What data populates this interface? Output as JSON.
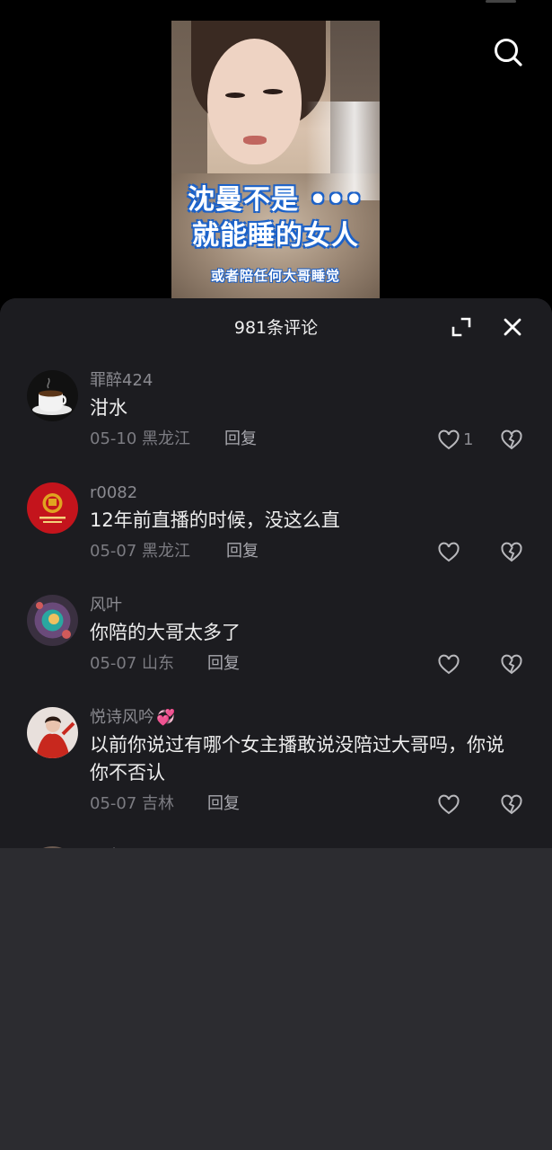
{
  "icons": {
    "search": "search-icon",
    "expand": "expand-icon",
    "close": "close-icon",
    "like": "heart-icon",
    "dislike": "broken-heart-icon"
  },
  "colors": {
    "panel_background": "#1c1c20",
    "page_background": "#000000",
    "secondary_text": "#8a8a90",
    "caption_outline": "#1d5fc4"
  },
  "video": {
    "caption_line1": "沈曼不是 •••",
    "caption_line2": "就能睡的女人",
    "caption_line3": "或者陪任何大哥睡觉"
  },
  "comments_panel": {
    "title": "981条评论",
    "reply_label": "回复",
    "comments": [
      {
        "user": "罪醉424",
        "text": "泔水",
        "date": "05-10",
        "location": "黑龙江",
        "likes": "1"
      },
      {
        "user": "r0082",
        "text": "12年前直播的时候，没这么直",
        "date": "05-07",
        "location": "黑龙江",
        "likes": ""
      },
      {
        "user": "风叶",
        "text": "你陪的大哥太多了",
        "date": "05-07",
        "location": "山东",
        "likes": ""
      },
      {
        "user": "悦诗风吟",
        "user_emoji": "💞",
        "text": "以前你说过有哪个女主播敢说没陪过大哥吗，你说你不否认",
        "date": "05-07",
        "location": "吉林",
        "likes": ""
      },
      {
        "user": "王大",
        "text": "",
        "date": "",
        "location": "",
        "likes": ""
      }
    ]
  }
}
